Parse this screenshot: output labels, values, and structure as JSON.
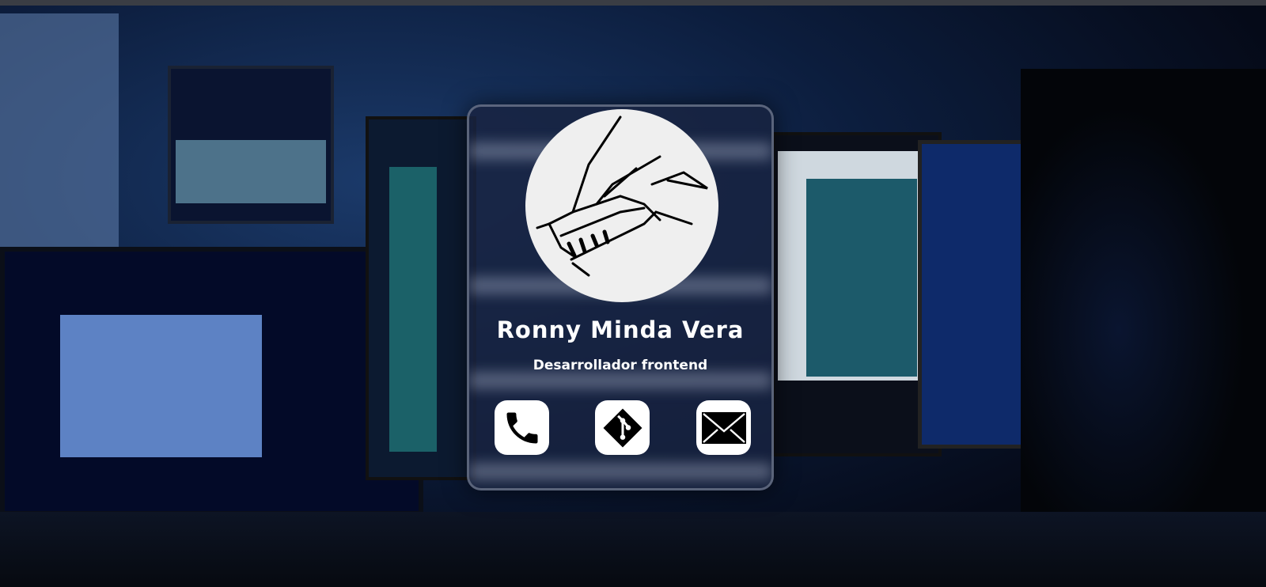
{
  "profile": {
    "name": "Ronny Minda Vera",
    "role": "Desarrollador frontend",
    "avatar_icon": "dragon-logo-icon"
  },
  "contacts": [
    {
      "icon": "phone-icon"
    },
    {
      "icon": "git-icon"
    },
    {
      "icon": "mail-icon"
    }
  ],
  "colors": {
    "card_bg": "#19233f",
    "accent": "#ffffff"
  }
}
